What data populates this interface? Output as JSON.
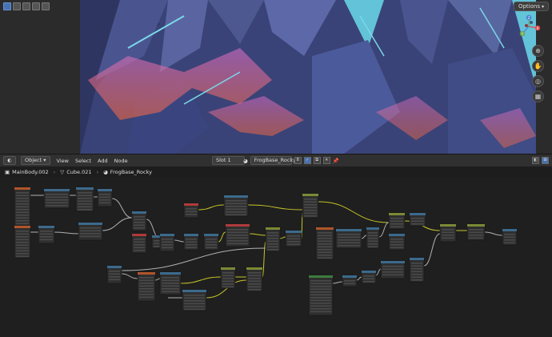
{
  "viewport": {
    "options_label": "Options",
    "gizmo": {
      "x_label": "X",
      "y_label": "Y",
      "z_label": "Z"
    },
    "nav_icons": [
      "zoom-icon",
      "hand-icon",
      "camera-icon",
      "grid-icon"
    ]
  },
  "header": {
    "editor_type_icon": "node-editor-icon",
    "object_label": "Object",
    "menu": [
      "View",
      "Select",
      "Add",
      "Node"
    ],
    "slot_label": "Slot 1",
    "material_name": "FrogBase_Rocky",
    "material_users": "8"
  },
  "breadcrumb": {
    "object": "MainBody.002",
    "mesh": "Cube.021",
    "material": "FrogBase_Rocky"
  },
  "colors": {
    "header_blue": "#4772b3",
    "wire_yellow": "#c7c729",
    "wire_grey": "#b0b0b0",
    "node_red": "#b03a3a",
    "node_blue": "#3c6a8c",
    "node_green": "#3e7a3e",
    "node_orange": "#b0552a",
    "node_olive": "#7a8a35"
  }
}
